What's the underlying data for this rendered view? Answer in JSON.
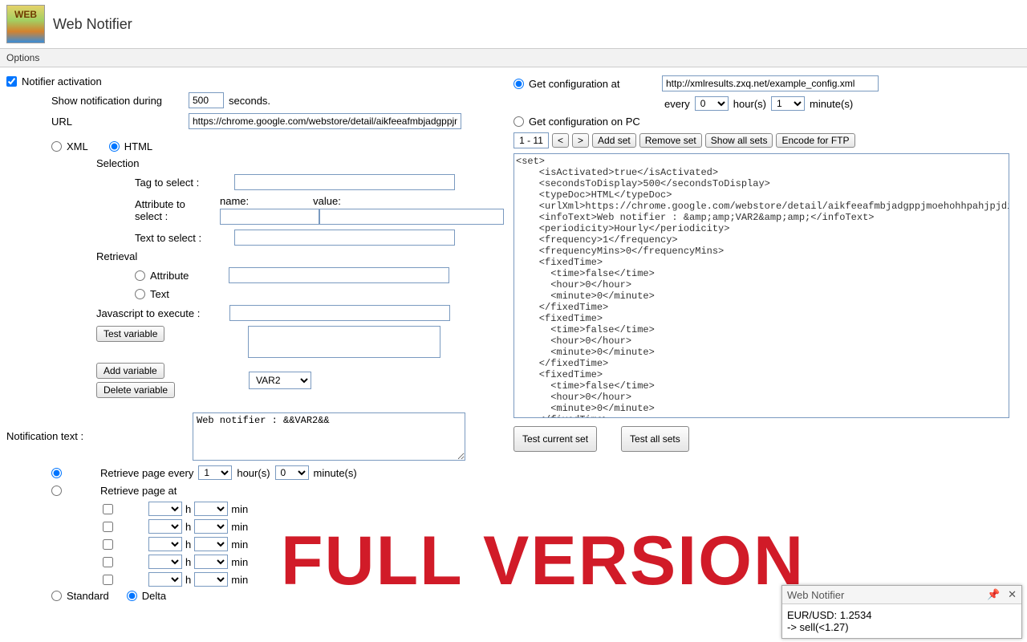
{
  "app": {
    "title": "Web Notifier",
    "logo_text": "WEB"
  },
  "options_label": "Options",
  "left": {
    "notifier_activation": "Notifier activation",
    "show_notification_during": "Show notification during",
    "seconds_value": "500",
    "seconds_label": "seconds.",
    "url_label": "URL",
    "url_value": "https://chrome.google.com/webstore/detail/aikfeeafmbjadgppjmoehoh",
    "xml_label": "XML",
    "html_label": "HTML",
    "selection_label": "Selection",
    "tag_to_select": "Tag to select :",
    "attribute_to_select": "Attribute to select :",
    "attr_name_label": "name:",
    "attr_value_label": "value:",
    "text_to_select": "Text to select :",
    "retrieval_label": "Retrieval",
    "attribute_radio": "Attribute",
    "text_radio": "Text",
    "javascript_to_execute": "Javascript to execute :",
    "test_variable": "Test variable",
    "add_variable": "Add variable",
    "delete_variable": "Delete variable",
    "var_select": "VAR2",
    "notification_text_label": "Notification text :",
    "notification_text_value": "Web notifier : &&VAR2&&",
    "retrieve_every": "Retrieve page every",
    "retrieve_every_hours": "1",
    "retrieve_every_hours_label": "hour(s)",
    "retrieve_every_mins": "0",
    "retrieve_every_mins_label": "minute(s)",
    "retrieve_at": "Retrieve page at",
    "h_label": "h",
    "min_label": "min",
    "standard_label": "Standard",
    "delta_label": "Delta"
  },
  "right": {
    "get_config_at": "Get configuration at",
    "config_url": "http://xmlresults.zxq.net/example_config.xml",
    "every_label": "every",
    "every_hours": "0",
    "hours_label": "hour(s)",
    "every_mins": "1",
    "mins_label": "minute(s)",
    "get_config_pc": "Get configuration on PC",
    "set_range": "1 - 11",
    "prev": "<",
    "next": ">",
    "add_set": "Add set",
    "remove_set": "Remove set",
    "show_all_sets": "Show all sets",
    "encode_ftp": "Encode for FTP",
    "xml_content": "<set>\n    <isActivated>true</isActivated>\n    <secondsToDisplay>500</secondsToDisplay>\n    <typeDoc>HTML</typeDoc>\n    <urlXml>https://chrome.google.com/webstore/detail/aikfeeafmbjadgppjmoehohhpahjpjdi?utm_source=chrome-ntp-icon </urlXml>\n    <infoText>Web notifier : &amp;amp;VAR2&amp;amp;</infoText>\n    <periodicity>Hourly</periodicity>\n    <frequency>1</frequency>\n    <frequencyMins>0</frequencyMins>\n    <fixedTime>\n      <time>false</time>\n      <hour>0</hour>\n      <minute>0</minute>\n    </fixedTime>\n    <fixedTime>\n      <time>false</time>\n      <hour>0</hour>\n      <minute>0</minute>\n    </fixedTime>\n    <fixedTime>\n      <time>false</time>\n      <hour>0</hour>\n      <minute>0</minute>\n    </fixedTime>\n    <fixedTime>",
    "test_current": "Test current set",
    "test_all": "Test all sets"
  },
  "full_version": "FULL VERSION",
  "popup": {
    "title": "Web Notifier",
    "line1": "EUR/USD: 1.2534",
    "line2": "-> sell(<1.27)"
  }
}
